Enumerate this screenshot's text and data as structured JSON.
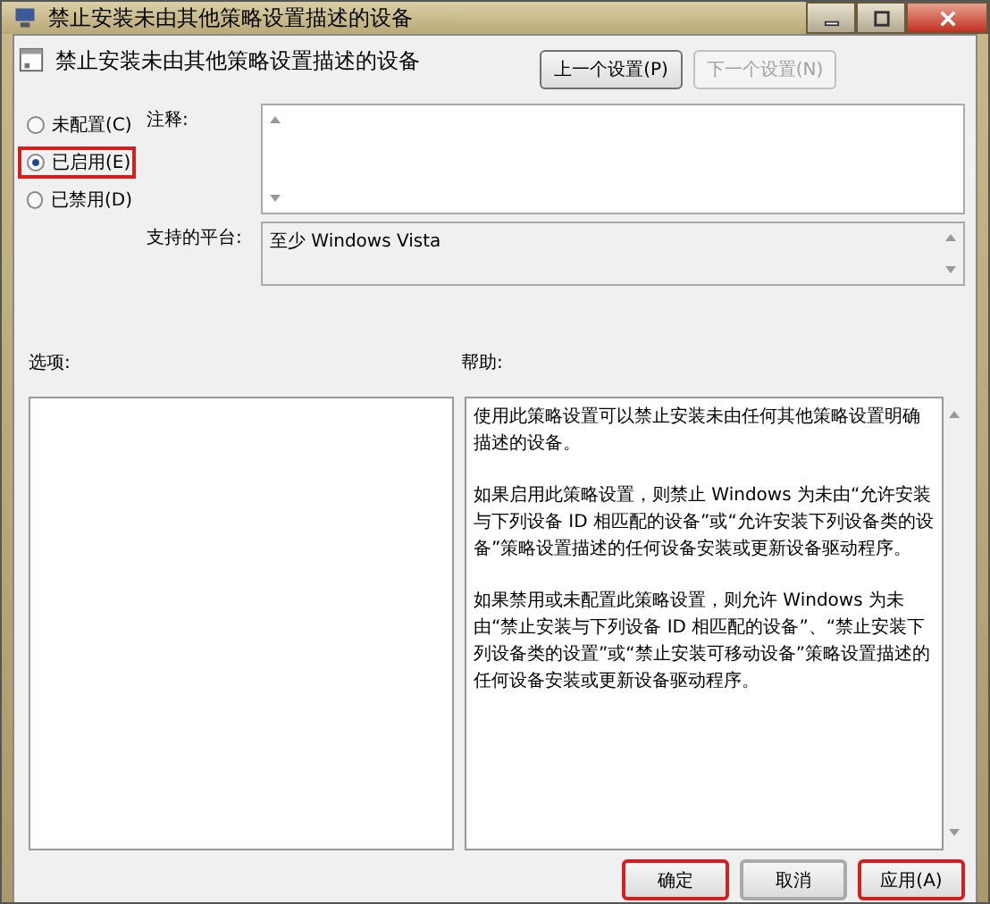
{
  "window": {
    "title": "禁止安装未由其他策略设置描述的设备"
  },
  "header": {
    "title": "禁止安装未由其他策略设置描述的设备"
  },
  "nav_buttons": [
    {
      "label": "上一个设置(P)",
      "disabled": false
    },
    {
      "label": "下一个设置(N)",
      "disabled": true
    }
  ],
  "state_options": [
    {
      "label": "未配置(C)",
      "selected": false,
      "highlighted": false
    },
    {
      "label": "已启用(E)",
      "selected": true,
      "highlighted": true
    },
    {
      "label": "已禁用(D)",
      "selected": false,
      "highlighted": false
    }
  ],
  "comment": {
    "label": "注释:"
  },
  "platform": {
    "label": "支持的平台:",
    "value": "至少 Windows Vista"
  },
  "options": {
    "label": "选项:"
  },
  "help": {
    "label": "帮助:",
    "paragraphs": [
      "使用此策略设置可以禁止安装未由任何其他策略设置明确描述的设备。",
      "如果启用此策略设置，则禁止 Windows 为未由“允许安装与下列设备 ID 相匹配的设备”或“允许安装下列设备类的设备”策略设置描述的任何设备安装或更新设备驱动程序。",
      "如果禁用或未配置此策略设置，则允许 Windows 为未由“禁止安装与下列设备 ID 相匹配的设备”、“禁止安装下列设备类的设置”或“禁止安装可移动设备”策略设置描述的任何设备安装或更新设备驱动程序。"
    ]
  },
  "buttons": [
    {
      "label": "确定",
      "highlighted": true
    },
    {
      "label": "取消",
      "highlighted": false
    },
    {
      "label": "应用(A)",
      "highlighted": true
    }
  ]
}
